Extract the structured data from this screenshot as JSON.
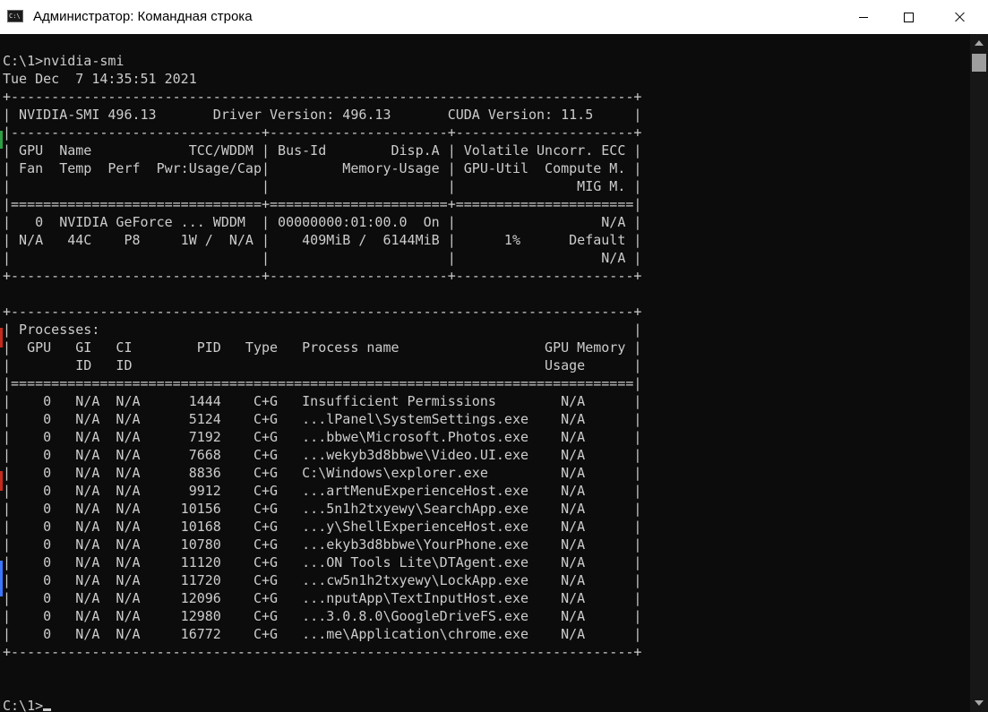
{
  "window": {
    "title": "Администратор: Командная строка",
    "icon_text": "C:\\",
    "icon": "cmd-icon",
    "buttons": [
      "minimize-icon",
      "maximize-icon",
      "close-icon"
    ]
  },
  "terminal": {
    "lines": [
      "C:\\1>nvidia-smi",
      "Tue Dec  7 14:35:51 2021",
      "+-----------------------------------------------------------------------------+",
      "| NVIDIA-SMI 496.13       Driver Version: 496.13       CUDA Version: 11.5     |",
      "|-------------------------------+----------------------+----------------------+",
      "| GPU  Name            TCC/WDDM | Bus-Id        Disp.A | Volatile Uncorr. ECC |",
      "| Fan  Temp  Perf  Pwr:Usage/Cap|         Memory-Usage | GPU-Util  Compute M. |",
      "|                               |                      |               MIG M. |",
      "|===============================+======================+======================|",
      "|   0  NVIDIA GeForce ... WDDM  | 00000000:01:00.0  On |                  N/A |",
      "| N/A   44C    P8     1W /  N/A |    409MiB /  6144MiB |      1%      Default |",
      "|                               |                      |                  N/A |",
      "+-------------------------------+----------------------+----------------------+",
      "",
      "+-----------------------------------------------------------------------------+",
      "| Processes:                                                                  |",
      "|  GPU   GI   CI        PID   Type   Process name                  GPU Memory |",
      "|        ID   ID                                                   Usage      |",
      "|=============================================================================|",
      "|    0   N/A  N/A      1444    C+G   Insufficient Permissions        N/A      |",
      "|    0   N/A  N/A      5124    C+G   ...lPanel\\SystemSettings.exe    N/A      |",
      "|    0   N/A  N/A      7192    C+G   ...bbwe\\Microsoft.Photos.exe    N/A      |",
      "|    0   N/A  N/A      7668    C+G   ...wekyb3d8bbwe\\Video.UI.exe    N/A      |",
      "|    0   N/A  N/A      8836    C+G   C:\\Windows\\explorer.exe         N/A      |",
      "|    0   N/A  N/A      9912    C+G   ...artMenuExperienceHost.exe    N/A      |",
      "|    0   N/A  N/A     10156    C+G   ...5n1h2txyewy\\SearchApp.exe    N/A      |",
      "|    0   N/A  N/A     10168    C+G   ...y\\ShellExperienceHost.exe    N/A      |",
      "|    0   N/A  N/A     10780    C+G   ...ekyb3d8bbwe\\YourPhone.exe    N/A      |",
      "|    0   N/A  N/A     11120    C+G   ...ON Tools Lite\\DTAgent.exe    N/A      |",
      "|    0   N/A  N/A     11720    C+G   ...cw5n1h2txyewy\\LockApp.exe    N/A      |",
      "|    0   N/A  N/A     12096    C+G   ...nputApp\\TextInputHost.exe    N/A      |",
      "|    0   N/A  N/A     12980    C+G   ...3.0.8.0\\GoogleDriveFS.exe    N/A      |",
      "|    0   N/A  N/A     16772    C+G   ...me\\Application\\chrome.exe    N/A      |",
      "+-----------------------------------------------------------------------------+",
      "",
      ""
    ],
    "prompt": "C:\\1>"
  },
  "colors": {
    "background": "#0c0c0c",
    "text": "#cccccc",
    "titlebar": "#ffffff",
    "gutter_green": "#2ea043",
    "gutter_red": "#c42b1c",
    "gutter_blue": "#3b78ff"
  }
}
